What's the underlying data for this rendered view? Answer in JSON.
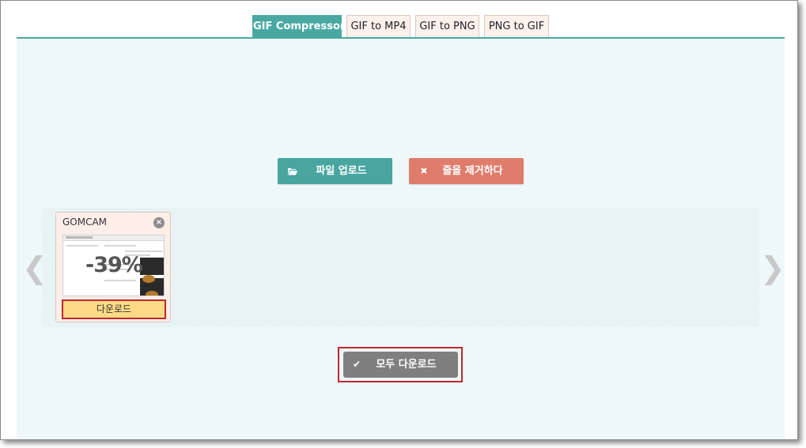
{
  "tabs": [
    {
      "label": "GIF Compressor",
      "active": true
    },
    {
      "label": "GIF to MP4",
      "active": false
    },
    {
      "label": "GIF to PNG",
      "active": false
    },
    {
      "label": "PNG to GIF",
      "active": false
    }
  ],
  "toolbar": {
    "upload_label": "파일 업로드",
    "upload_icon": "folder-open-icon",
    "clear_label": "줄을 제거하다",
    "clear_icon": "close-icon"
  },
  "files": [
    {
      "name": "GOMCAM",
      "reduction": "-39%",
      "download_label": "다운로드"
    }
  ],
  "download_all": {
    "label": "모두 다운로드",
    "icon": "check-icon"
  },
  "nav": {
    "prev": "❮",
    "next": "❯"
  },
  "colors": {
    "accent": "#4aa8a3",
    "danger": "#e07c6b",
    "highlight": "#c0272d",
    "download_bg": "#fddb86",
    "download_all_bg": "#7f7f7f"
  }
}
